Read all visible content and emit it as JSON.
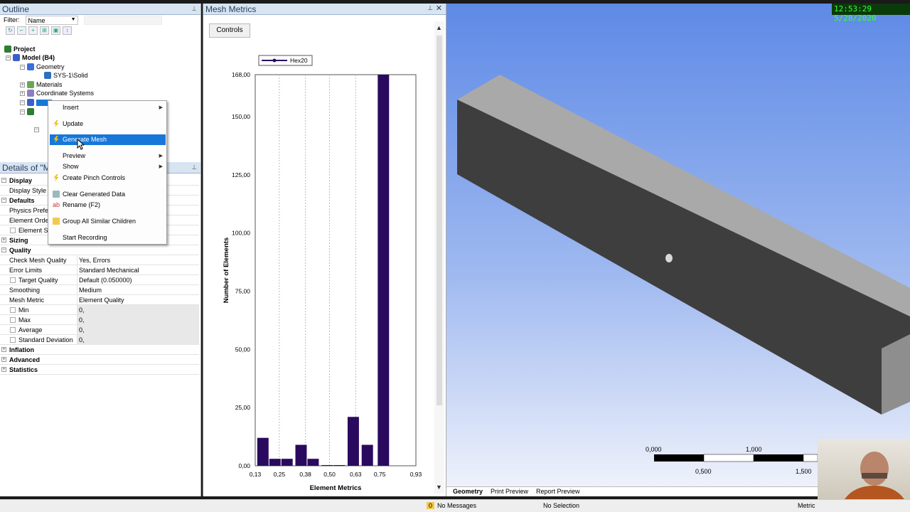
{
  "outline": {
    "title": "Outline",
    "filter_label": "Filter:",
    "filter_value": "Name",
    "tree": [
      {
        "label": "Project",
        "bold": true
      },
      {
        "label": "Model (B4)",
        "bold": true
      },
      {
        "label": "Geometry"
      },
      {
        "label": "SYS-1\\Solid"
      },
      {
        "label": "Materials"
      },
      {
        "label": "Coordinate Systems"
      }
    ]
  },
  "context_menu": {
    "items": [
      {
        "label": "Insert",
        "submenu": true
      },
      {
        "label": "Update",
        "icon": "update-bolt-icon"
      },
      {
        "label": "Generate Mesh",
        "icon": "generate-mesh-bolt-icon",
        "selected": true
      },
      {
        "label": "Preview",
        "submenu": true
      },
      {
        "label": "Show",
        "submenu": true
      },
      {
        "label": "Create Pinch Controls",
        "icon": "pinch-bolt-icon"
      },
      {
        "label": "Clear Generated Data",
        "icon": "eraser-icon"
      },
      {
        "label": "Rename (F2)",
        "icon": "rename-icon"
      },
      {
        "label": "Group All Similar Children",
        "icon": "folder-icon"
      },
      {
        "label": "Start Recording"
      }
    ]
  },
  "details": {
    "title": "Details of \"M",
    "rows": [
      {
        "k": "Display",
        "section": true
      },
      {
        "k": "Display Style"
      },
      {
        "k": "Defaults",
        "section": true
      },
      {
        "k": "Physics Prefere"
      },
      {
        "k": "Element Orde"
      },
      {
        "k": "Element Si",
        "cb": true
      },
      {
        "k": "Sizing",
        "section": true,
        "collapsed": true
      },
      {
        "k": "Quality",
        "section": true
      },
      {
        "k": "Check Mesh Quality",
        "v": "Yes, Errors"
      },
      {
        "k": "Error Limits",
        "v": "Standard Mechanical"
      },
      {
        "k": "Target Quality",
        "v": "Default (0.050000)",
        "cb": true
      },
      {
        "k": "Smoothing",
        "v": "Medium"
      },
      {
        "k": "Mesh Metric",
        "v": "Element Quality"
      },
      {
        "k": "Min",
        "v": "0,",
        "cb": true,
        "gray": true
      },
      {
        "k": "Max",
        "v": "0,",
        "cb": true,
        "gray": true
      },
      {
        "k": "Average",
        "v": "0,",
        "cb": true,
        "gray": true
      },
      {
        "k": "Standard Deviation",
        "v": "0,",
        "cb": true,
        "gray": true
      },
      {
        "k": "Inflation",
        "section": true,
        "collapsed": true
      },
      {
        "k": "Advanced",
        "section": true,
        "collapsed": true
      },
      {
        "k": "Statistics",
        "section": true,
        "collapsed": true
      }
    ]
  },
  "metrics": {
    "title": "Mesh Metrics",
    "controls_label": "Controls"
  },
  "chart_data": {
    "type": "bar",
    "xlabel": "Element Metrics",
    "ylabel": "Number of Elements",
    "legend": "Hex20",
    "ylim": [
      0,
      168
    ],
    "xlim": [
      0.13,
      0.93
    ],
    "y_ticks": [
      "0,00",
      "25,00",
      "50,00",
      "75,00",
      "100,00",
      "125,00",
      "150,00",
      "168,00"
    ],
    "y_tick_values": [
      0,
      25,
      50,
      75,
      100,
      125,
      150,
      168
    ],
    "x_ticks": [
      "0,13",
      "0,25",
      "0,38",
      "0,50",
      "0,63",
      "0,75",
      "0,93"
    ],
    "x_tick_values": [
      0.13,
      0.25,
      0.38,
      0.5,
      0.63,
      0.75,
      0.93
    ],
    "bar_color": "#2a0a5e",
    "bars": [
      {
        "x": 0.17,
        "value": 12
      },
      {
        "x": 0.23,
        "value": 3
      },
      {
        "x": 0.29,
        "value": 3
      },
      {
        "x": 0.36,
        "value": 9
      },
      {
        "x": 0.42,
        "value": 3
      },
      {
        "x": 0.49,
        "value": 0
      },
      {
        "x": 0.55,
        "value": 0
      },
      {
        "x": 0.62,
        "value": 21
      },
      {
        "x": 0.69,
        "value": 9
      },
      {
        "x": 0.77,
        "value": 168
      }
    ]
  },
  "viewport": {
    "clock": "12:53:29  5/28/2020",
    "scale_labels": [
      "0,000",
      "1,000",
      "0,500",
      "1,500"
    ],
    "tabs": [
      "Geometry",
      "Print Preview",
      "Report Preview"
    ]
  },
  "statusbar": {
    "messages_count": "0",
    "messages": "No Messages",
    "selection": "No Selection",
    "units": "Metric"
  }
}
